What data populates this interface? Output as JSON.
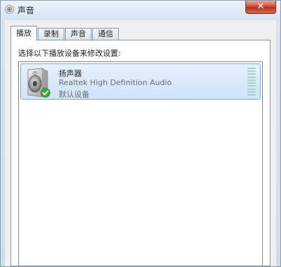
{
  "window": {
    "title": "声音",
    "close_label": "✕",
    "title_icon": "speaker-icon",
    "accent_color": "#84acdd"
  },
  "tabs": [
    {
      "label": "播放",
      "active": true
    },
    {
      "label": "录制",
      "active": false
    },
    {
      "label": "声音",
      "active": false
    },
    {
      "label": "通信",
      "active": false
    }
  ],
  "playback": {
    "instruction": "选择以下播放设备来修改设置:",
    "devices": [
      {
        "name": "扬声器",
        "driver": "Realtek High Definition Audio",
        "status": "默认设备",
        "icon": "speaker-icon",
        "badge_icon": "green-check-icon"
      }
    ]
  }
}
